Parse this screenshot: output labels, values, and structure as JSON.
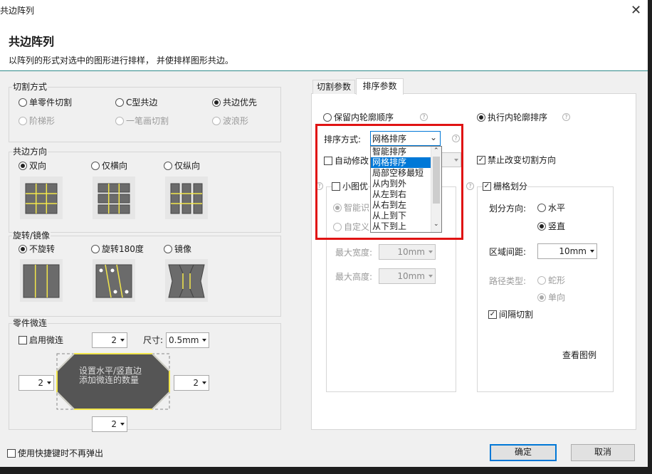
{
  "window": {
    "title": "共边阵列",
    "close_icon": "close-icon"
  },
  "header": {
    "title": "共边阵列",
    "description": "以阵列的形式对选中的图形进行排样， 并使排样图形共边。"
  },
  "cut_mode": {
    "label": "切割方式",
    "options": [
      {
        "label": "单零件切割",
        "checked": false,
        "enabled": true
      },
      {
        "label": "C型共边",
        "checked": false,
        "enabled": true
      },
      {
        "label": "共边优先",
        "checked": true,
        "enabled": true
      },
      {
        "label": "阶梯形",
        "checked": false,
        "enabled": false
      },
      {
        "label": "一笔画切割",
        "checked": false,
        "enabled": false
      },
      {
        "label": "波浪形",
        "checked": false,
        "enabled": false
      }
    ]
  },
  "edge_direction": {
    "label": "共边方向",
    "options": [
      {
        "label": "双向",
        "checked": true
      },
      {
        "label": "仅横向",
        "checked": false
      },
      {
        "label": "仅纵向",
        "checked": false
      }
    ]
  },
  "rotation": {
    "label": "旋转/镜像",
    "options": [
      {
        "label": "不旋转",
        "checked": true
      },
      {
        "label": "旋转180度",
        "checked": false
      },
      {
        "label": "镜像",
        "checked": false
      }
    ]
  },
  "micro_joint": {
    "label": "零件微连",
    "enable_label": "启用微连",
    "enabled": false,
    "top_count": "2",
    "size_label": "尺寸:",
    "size_value": "0.5mm",
    "left_count": "2",
    "right_count": "2",
    "bottom_count": "2",
    "hint_line1": "设置水平/竖直边",
    "hint_line2": "添加微连的数量"
  },
  "tabs": [
    {
      "label": "切割参数",
      "active": false
    },
    {
      "label": "排序参数",
      "active": true
    }
  ],
  "sort": {
    "keep_inner_order": "保留内轮廓顺序",
    "exec_inner_sort": "执行内轮廓排序",
    "method_label": "排序方式:",
    "method_value": "网格排序",
    "dropdown_options": [
      "智能排序",
      "网格排序",
      "局部空移最短",
      "从内到外",
      "从左到右",
      "从右到左",
      "从上到下",
      "从下到上"
    ],
    "dropdown_selected": 1,
    "auto_modify_label": "自动修改",
    "forbid_change_dir": "禁止改变切割方向",
    "small_first_label": "小图优",
    "smart_label": "智能识",
    "custom_label": "自定义",
    "max_width_label": "最大宽度:",
    "max_width_value": "10mm",
    "max_height_label": "最大高度:",
    "max_height_value": "10mm",
    "grid_label": "栅格划分",
    "grid_checked": true,
    "split_dir_label": "划分方向:",
    "horizontal_label": "水平",
    "vertical_label": "竖直",
    "vertical_checked": true,
    "region_gap_label": "区域间距:",
    "region_gap_value": "10mm",
    "path_type_label": "路径类型:",
    "snake_label": "蛇形",
    "single_label": "单向",
    "interval_cut_label": "间隔切割",
    "interval_cut_checked": true,
    "view_example": "查看图例"
  },
  "footer": {
    "no_popup_label": "使用快捷键时不再弹出",
    "ok_label": "确定",
    "cancel_label": "取消"
  },
  "colors": {
    "accent_red": "#e01313",
    "selection_blue": "#0078d7",
    "part_gray": "#6b6b6b",
    "cut_line_yellow": "#f2e64a"
  }
}
